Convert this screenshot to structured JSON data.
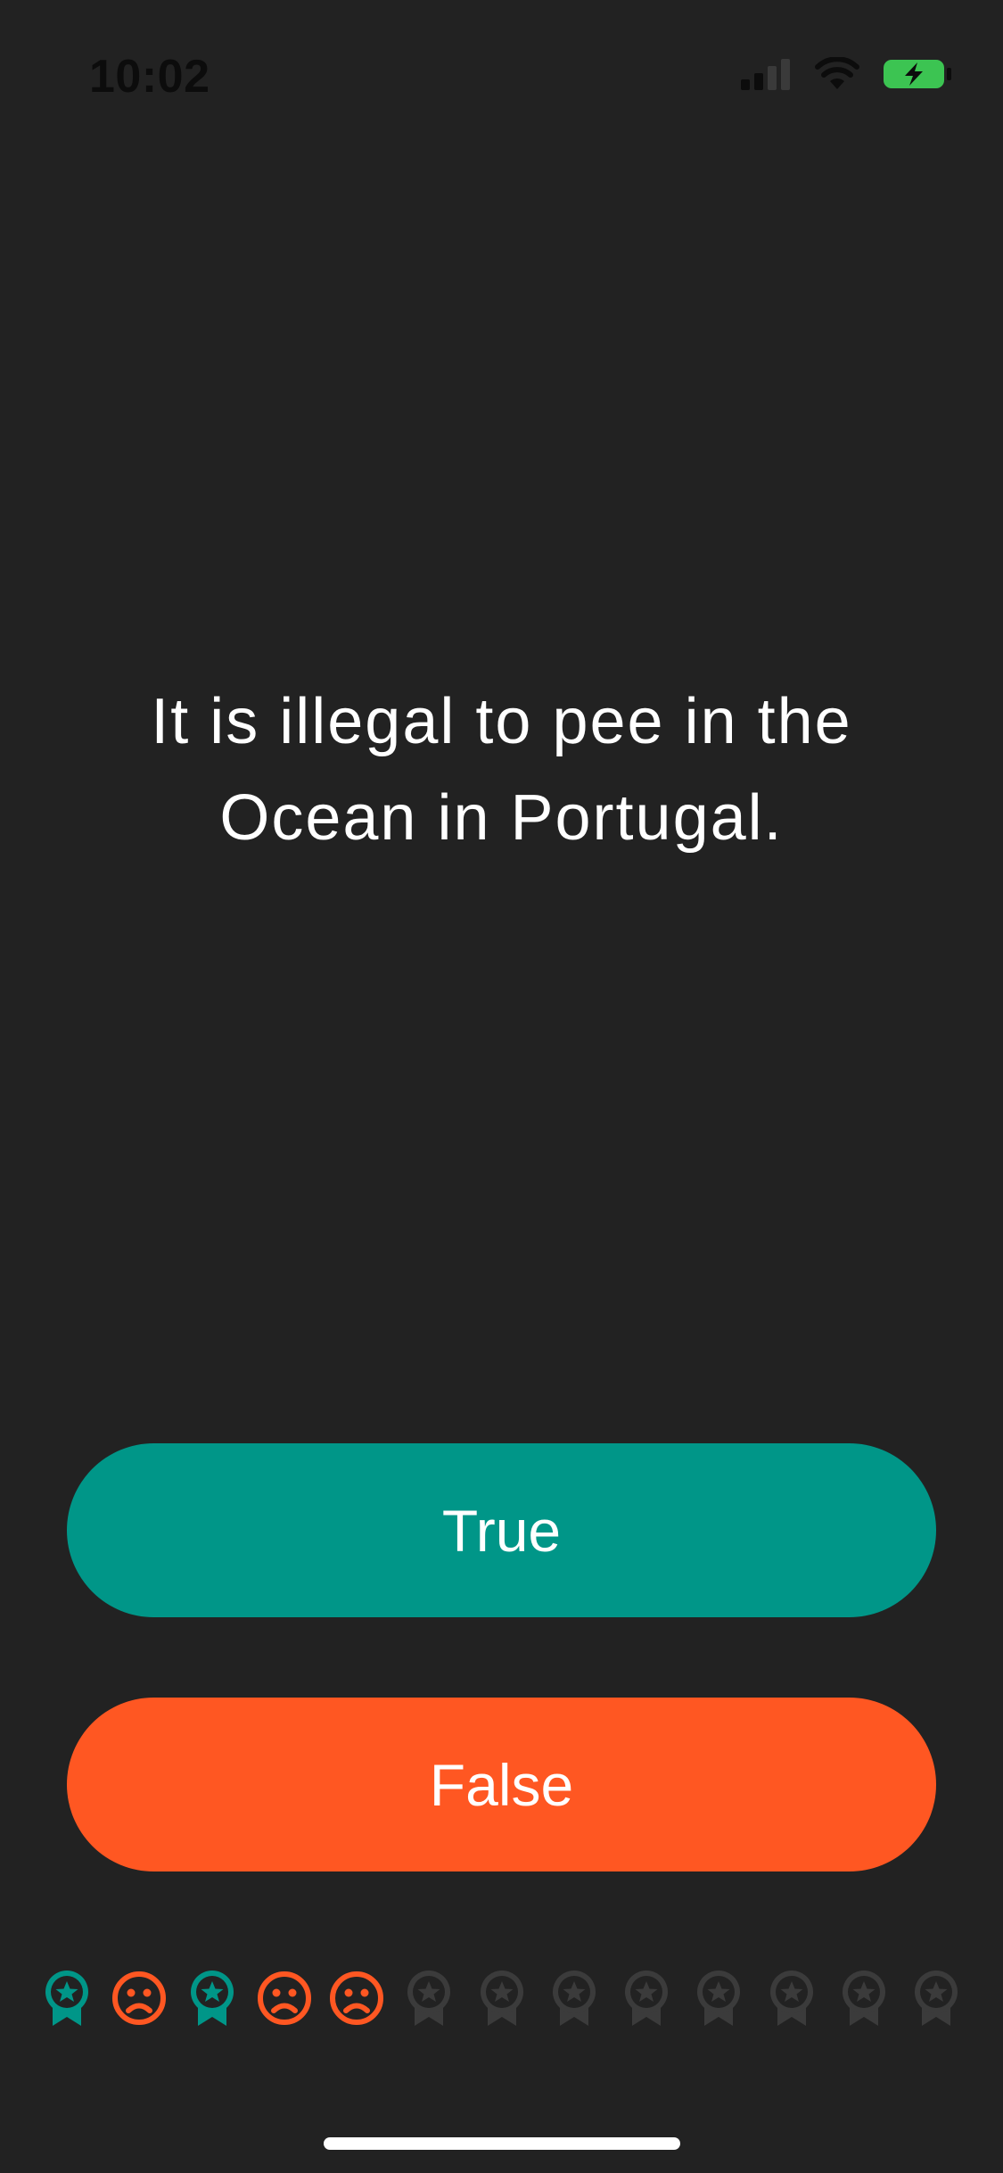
{
  "status_bar": {
    "time": "10:02",
    "time_color": "#0c0c0c",
    "battery_color": "#3cc452",
    "icons": [
      "cellular-signal-icon",
      "wifi-icon",
      "battery-charging-icon"
    ]
  },
  "question": {
    "text": "It is illegal to pee in the Ocean in Portugal."
  },
  "answers": {
    "true_label": "True",
    "false_label": "False"
  },
  "progress": {
    "total": 13,
    "answered": 5,
    "items": [
      "correct",
      "wrong",
      "correct",
      "wrong",
      "wrong",
      "pending",
      "pending",
      "pending",
      "pending",
      "pending",
      "pending",
      "pending",
      "pending"
    ]
  },
  "colors": {
    "background": "#222222",
    "true": "#009688",
    "false": "#ff5722",
    "pending": "#3b3b3b"
  }
}
